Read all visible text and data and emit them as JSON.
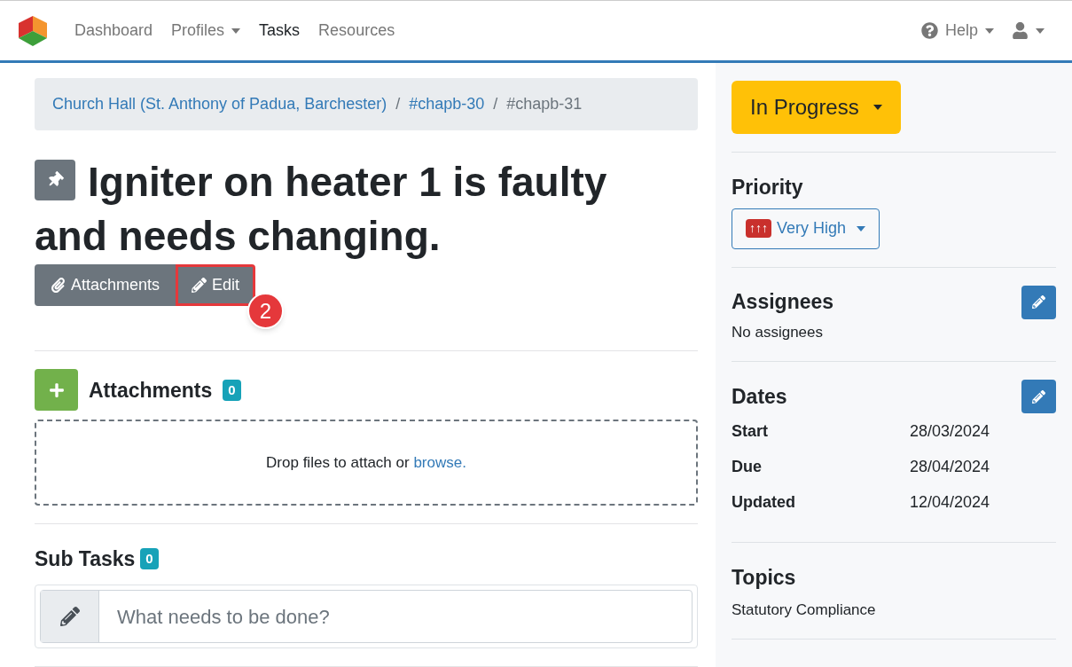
{
  "nav": {
    "items": [
      {
        "label": "Dashboard",
        "dropdown": false,
        "selected": false
      },
      {
        "label": "Profiles",
        "dropdown": true,
        "selected": false
      },
      {
        "label": "Tasks",
        "dropdown": false,
        "selected": true
      },
      {
        "label": "Resources",
        "dropdown": false,
        "selected": false
      }
    ],
    "help": "Help"
  },
  "breadcrumb": [
    {
      "label": "Church Hall (St. Anthony of Padua, Barchester)",
      "link": true
    },
    {
      "separator": "/",
      "label": "#chapb-30",
      "link": true
    },
    {
      "separator": "/",
      "label": "#chapb-31",
      "link": false
    }
  ],
  "title": "Igniter on heater 1 is faulty and needs changing.",
  "actions": [
    {
      "label": "Attachments",
      "kind": "attach",
      "highlighted": false
    },
    {
      "label": "Edit",
      "kind": "edit",
      "highlighted": true
    }
  ],
  "annotation": {
    "number": "2"
  },
  "attachments": {
    "heading": "Attachments",
    "count": "0",
    "drop_text": "Drop files to attach or ",
    "browse": "browse."
  },
  "subtasks": {
    "heading": "Sub Tasks",
    "count": "0",
    "placeholder": "What needs to be done?"
  },
  "sidebar": {
    "status": "In Progress",
    "priority": {
      "heading": "Priority",
      "value": "Very High",
      "level_arrows": "↑↑↑"
    },
    "assignees": {
      "heading": "Assignees",
      "text": "No assignees"
    },
    "dates": {
      "heading": "Dates",
      "rows": [
        {
          "label": "Start",
          "value": "28/03/2024"
        },
        {
          "label": "Due",
          "value": "28/04/2024"
        },
        {
          "label": "Updated",
          "value": "12/04/2024"
        }
      ]
    },
    "topics": {
      "heading": "Topics",
      "text": "Statutory Compliance"
    }
  }
}
